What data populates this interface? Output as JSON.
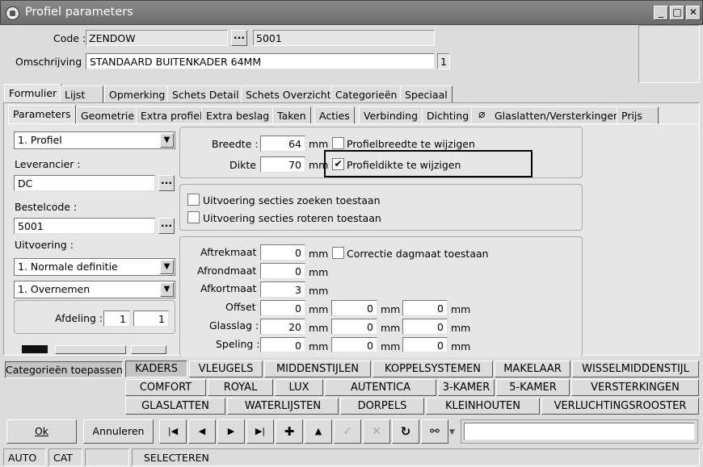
{
  "window": {
    "title": "Profiel parameters",
    "min": "_",
    "max": "□",
    "close": "✕"
  },
  "header": {
    "code_label": "Code :",
    "code_value": "ZENDOW",
    "code_dots": "...",
    "code_number": "5001",
    "omschrijving_label": "Omschrijving :",
    "omschrijving_value": "STANDAARD BUITENKADER 64MM",
    "omschrijving_count": "1"
  },
  "main_tabs": [
    "Formulier",
    "Lijst",
    "Opmerking",
    "Schets Detail",
    "Schets Overzicht",
    "Categorieën",
    "Speciaal"
  ],
  "sub_tabs": [
    "Parameters",
    "Geometrie",
    "Extra profiel",
    "Extra beslag",
    "Taken",
    "Acties",
    "Verbinding",
    "Dichting",
    "Glaslatten/Versterkingen",
    "Prijs"
  ],
  "left": {
    "profiel_select": "1.  Profiel",
    "leverancier_label": "Leverancier :",
    "leverancier_value": "DC",
    "bestelcode_label": "Bestelcode :",
    "bestelcode_value": "5001",
    "uitvoering_label": "Uitvoering :",
    "uitvoering_select": "1.  Normale definitie",
    "overnemen_select": "1.  Overnemen",
    "afdeling_label": "Afdeling :",
    "afdeling_value1": "1",
    "afdeling_value2": "1"
  },
  "dims": {
    "breedte_label": "Breedte :",
    "breedte_value": "64",
    "dikte_label": "Dikte :",
    "dikte_value": "70",
    "unit": "mm",
    "profielbreedte_label": "Profielbreedte te wijzigen",
    "profielbreedte_checked": false,
    "profieldikte_label": "Profieldikte te wijzigen",
    "profieldikte_checked": true
  },
  "secties": {
    "zoeken_label": "Uitvoering secties zoeken toestaan",
    "roteren_label": "Uitvoering secties roteren toestaan"
  },
  "maten": {
    "unit": "mm",
    "correctie_label": "Correctie dagmaat toestaan",
    "rows": [
      {
        "label": "Aftrekmaat :",
        "v1": "0"
      },
      {
        "label": "Afrondmaat :",
        "v1": "0"
      },
      {
        "label": "Afkortmaat :",
        "v1": "3"
      },
      {
        "label": "Offset :",
        "v1": "0",
        "v2": "0",
        "v3": "0"
      },
      {
        "label": "Glasslag :",
        "v1": "20",
        "v2": "0",
        "v3": "0"
      },
      {
        "label": "Speling :",
        "v1": "0",
        "v2": "0",
        "v3": "0"
      }
    ]
  },
  "categories": {
    "apply_label": "Categorieën toepassen",
    "row1": [
      "KADERS",
      "VLEUGELS",
      "MIDDENSTIJLEN",
      "KOPPELSYSTEMEN",
      "MAKELAAR",
      "WISSELMIDDENSTIJL"
    ],
    "row2": [
      "COMFORT",
      "ROYAL",
      "LUX",
      "AUTENTICA",
      "3-KAMER",
      "5-KAMER",
      "VERSTERKINGEN"
    ],
    "row3": [
      "GLASLATTEN",
      "WATERLIJSTEN",
      "DORPELS",
      "KLEINHOUTEN",
      "VERLUCHTINGSROOSTER"
    ]
  },
  "toolbar": {
    "ok_label": "Ok",
    "cancel_label": "Annuleren",
    "search_value": ""
  },
  "status": [
    "AUTO",
    "CAT",
    "",
    "SELECTEREN"
  ]
}
